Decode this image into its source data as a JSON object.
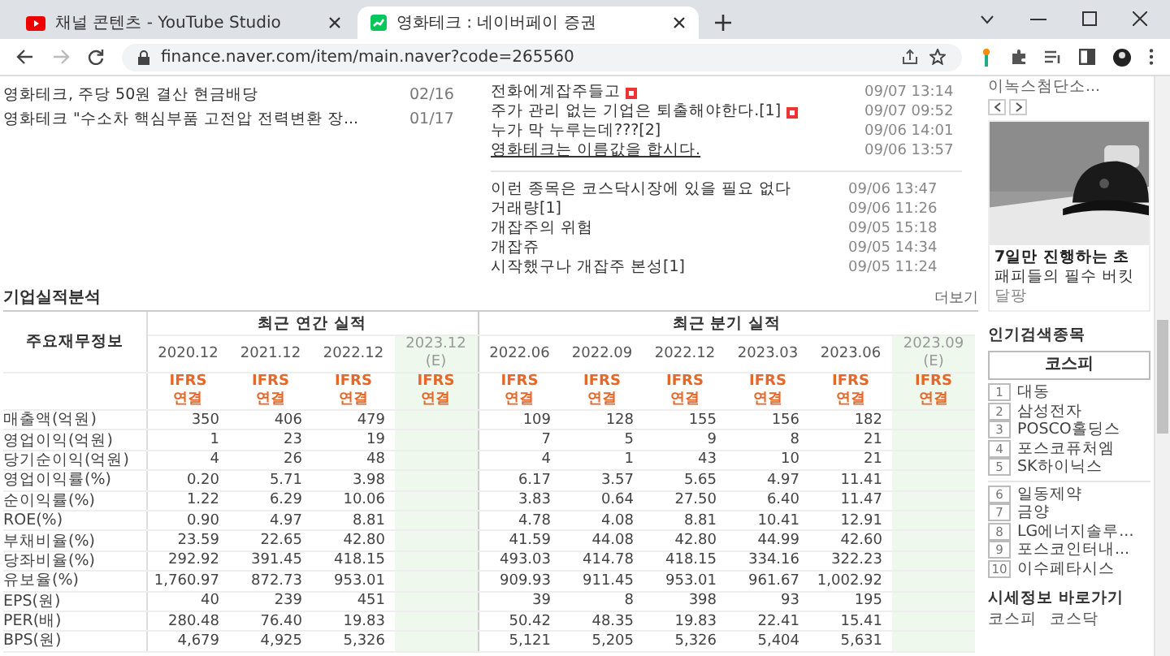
{
  "browser": {
    "tabs": [
      {
        "title": "채널 콘텐츠 - YouTube Studio",
        "selected": false
      },
      {
        "title": "영화테크 : 네이버페이 증권",
        "selected": true
      }
    ],
    "address": "finance.naver.com/item/main.naver?code=265560"
  },
  "company_news": [
    {
      "title": "영화테크, 주당 50원 결산 현금배당",
      "date": "02/16"
    },
    {
      "title": "영화테크 \"수소차 핵심부품 고전압 전력변환 장...",
      "date": "01/17"
    }
  ],
  "board_groups": [
    [
      {
        "title": "전화에계잡주들고",
        "date": "09/07 13:14",
        "new": true,
        "hovered": false
      },
      {
        "title": "주가 관리 없는 기업은 퇴출해야한다.[1]",
        "date": "09/07 09:52",
        "new": true,
        "hovered": false
      },
      {
        "title": "누가 막 누루는데???[2]",
        "date": "09/06 14:01",
        "new": false,
        "hovered": false
      },
      {
        "title": "영화테크는 이름값을 합시다.",
        "date": "09/06 13:57",
        "new": false,
        "hovered": true
      }
    ],
    [
      {
        "title": "이런 종목은 코스닥시장에 있을 필요 없다",
        "date": "09/06 13:47",
        "new": false,
        "hovered": false
      },
      {
        "title": "거래량[1]",
        "date": "09/06 11:26",
        "new": false,
        "hovered": false
      },
      {
        "title": "개잡주의 위험",
        "date": "09/05 15:18",
        "new": false,
        "hovered": false
      },
      {
        "title": "개잡쥬",
        "date": "09/05 14:34",
        "new": false,
        "hovered": false
      },
      {
        "title": "시작했구나 개잡주 본성[1]",
        "date": "09/05 11:24",
        "new": false,
        "hovered": false
      }
    ]
  ],
  "financials": {
    "title": "기업실적분석",
    "more": "더보기",
    "corner": "주요재무정보",
    "annual": {
      "label": "최근 연간 실적",
      "columns": [
        {
          "period": "2020.12",
          "estimate": false,
          "basis": "IFRS",
          "scope": "연결"
        },
        {
          "period": "2021.12",
          "estimate": false,
          "basis": "IFRS",
          "scope": "연결"
        },
        {
          "period": "2022.12",
          "estimate": false,
          "basis": "IFRS",
          "scope": "연결"
        },
        {
          "period": "2023.12",
          "mark": "(E)",
          "estimate": true,
          "basis": "IFRS",
          "scope": "연결"
        }
      ]
    },
    "quarter": {
      "label": "최근 분기 실적",
      "columns": [
        {
          "period": "2022.06",
          "estimate": false,
          "basis": "IFRS",
          "scope": "연결"
        },
        {
          "period": "2022.09",
          "estimate": false,
          "basis": "IFRS",
          "scope": "연결"
        },
        {
          "period": "2022.12",
          "estimate": false,
          "basis": "IFRS",
          "scope": "연결"
        },
        {
          "period": "2023.03",
          "estimate": false,
          "basis": "IFRS",
          "scope": "연결"
        },
        {
          "period": "2023.06",
          "estimate": false,
          "basis": "IFRS",
          "scope": "연결"
        },
        {
          "period": "2023.09",
          "mark": "(E)",
          "estimate": true,
          "basis": "IFRS",
          "scope": "연결"
        }
      ]
    },
    "row_groups": [
      [
        {
          "label": "매출액(억원)",
          "annual": [
            "350",
            "406",
            "479"
          ],
          "quarter": [
            "109",
            "128",
            "155",
            "156",
            "182"
          ]
        },
        {
          "label": "영업이익(억원)",
          "annual": [
            "1",
            "23",
            "19"
          ],
          "quarter": [
            "7",
            "5",
            "9",
            "8",
            "21"
          ]
        },
        {
          "label": "당기순이익(억원)",
          "annual": [
            "4",
            "26",
            "48"
          ],
          "quarter": [
            "4",
            "1",
            "43",
            "10",
            "21"
          ]
        }
      ],
      [
        {
          "label": "영업이익률(%)",
          "annual": [
            "0.20",
            "5.71",
            "3.98"
          ],
          "quarter": [
            "6.17",
            "3.57",
            "5.65",
            "4.97",
            "11.41"
          ]
        },
        {
          "label": "순이익률(%)",
          "annual": [
            "1.22",
            "6.29",
            "10.06"
          ],
          "quarter": [
            "3.83",
            "0.64",
            "27.50",
            "6.40",
            "11.47"
          ]
        },
        {
          "label": "ROE(%)",
          "annual": [
            "0.90",
            "4.97",
            "8.81"
          ],
          "quarter": [
            "4.78",
            "4.08",
            "8.81",
            "10.41",
            "12.91"
          ]
        }
      ],
      [
        {
          "label": "부채비율(%)",
          "annual": [
            "23.59",
            "22.65",
            "42.80"
          ],
          "quarter": [
            "41.59",
            "44.08",
            "42.80",
            "44.99",
            "42.60"
          ]
        },
        {
          "label": "당좌비율(%)",
          "annual": [
            "292.92",
            "391.45",
            "418.15"
          ],
          "quarter": [
            "493.03",
            "414.78",
            "418.15",
            "334.16",
            "322.23"
          ]
        },
        {
          "label": "유보율(%)",
          "annual": [
            "1,760.97",
            "872.73",
            "953.01"
          ],
          "quarter": [
            "909.93",
            "911.45",
            "953.01",
            "961.67",
            "1,002.92"
          ]
        }
      ],
      [
        {
          "label": "EPS(원)",
          "annual": [
            "40",
            "239",
            "451"
          ],
          "quarter": [
            "39",
            "8",
            "398",
            "93",
            "195"
          ]
        },
        {
          "label": "PER(배)",
          "annual": [
            "280.48",
            "76.40",
            "19.83"
          ],
          "quarter": [
            "50.42",
            "48.35",
            "19.83",
            "22.41",
            "15.41"
          ]
        },
        {
          "label": "BPS(원)",
          "annual": [
            "4,679",
            "4,925",
            "5,326"
          ],
          "quarter": [
            "5,121",
            "5,205",
            "5,326",
            "5,404",
            "5,631"
          ]
        }
      ]
    ]
  },
  "sidebar": {
    "top_item": "이녹스첨단소...",
    "ad": {
      "kind": "picture",
      "headline": "7일만 진행하는 초",
      "text": "패피들의 필수 버킷",
      "brand": "달팡"
    },
    "popular": {
      "title": "인기검색종목",
      "tab": "코스피",
      "groups": [
        [
          {
            "rank": "1",
            "name": "대동"
          },
          {
            "rank": "2",
            "name": "삼성전자"
          },
          {
            "rank": "3",
            "name": "POSCO홀딩스"
          },
          {
            "rank": "4",
            "name": "포스코퓨처엠"
          },
          {
            "rank": "5",
            "name": "SK하이닉스"
          }
        ],
        [
          {
            "rank": "6",
            "name": "일동제약"
          },
          {
            "rank": "7",
            "name": "금양"
          },
          {
            "rank": "8",
            "name": "LG에너지솔루..."
          },
          {
            "rank": "9",
            "name": "포스코인터내..."
          },
          {
            "rank": "10",
            "name": "이수페타시스"
          }
        ]
      ]
    },
    "quick": {
      "title": "시세정보 바로가기",
      "links": [
        "코스피",
        "코스닥"
      ]
    }
  }
}
